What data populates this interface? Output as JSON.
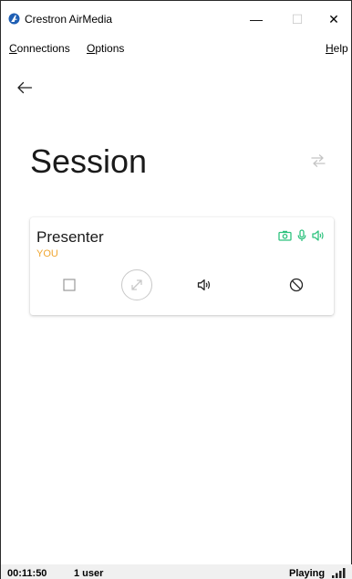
{
  "window": {
    "title": "Crestron AirMedia",
    "minimize_glyph": "—",
    "maximize_glyph": "☐",
    "close_glyph": "✕"
  },
  "menu": {
    "connections": {
      "mnemonic": "C",
      "rest": "onnections"
    },
    "options": {
      "mnemonic": "O",
      "rest": "ptions"
    },
    "help": {
      "mnemonic": "H",
      "rest": "elp"
    }
  },
  "page": {
    "title": "Session",
    "back_icon": "arrow-left-icon",
    "swap_icon": "swap-arrows-icon"
  },
  "presenter": {
    "name": "Presenter",
    "tag": "YOU",
    "status_icons": [
      "camera-icon",
      "microphone-icon",
      "speaker-icon"
    ],
    "controls": [
      "stop-icon",
      "fullscreen-icon",
      "speaker-icon",
      "block-icon"
    ]
  },
  "status_bar": {
    "timer": "00:11:50",
    "users": "1 user",
    "state": "Playing",
    "signal_icon": "signal-bars-icon"
  },
  "colors": {
    "accent_green": "#2ec27e",
    "you_orange": "#f0a630",
    "icon_gray": "#bdbdbd"
  }
}
